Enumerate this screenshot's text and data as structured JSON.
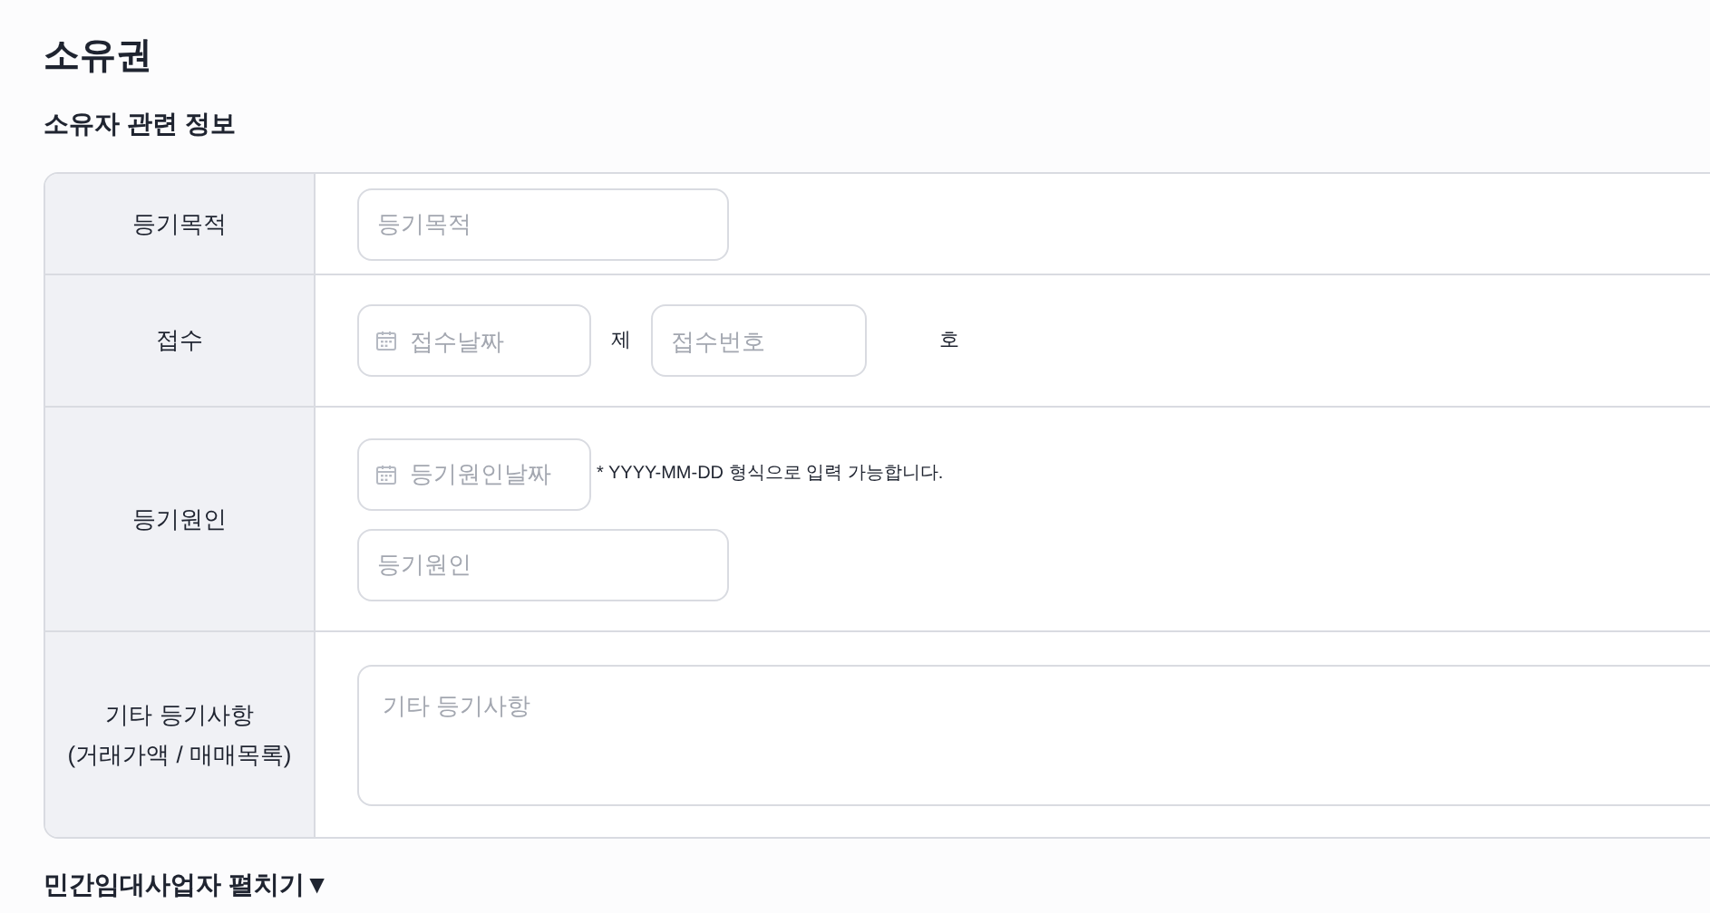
{
  "title": "소유권",
  "subtitle": "소유자 관련 정보",
  "rows": [
    {
      "label": "등기목적",
      "kind": "text",
      "fields": [
        {
          "kind": "text",
          "placeholder": "등기목적"
        }
      ]
    },
    {
      "label": "접수",
      "kind": "receipt",
      "fields": [
        {
          "kind": "date",
          "placeholder": "접수날짜"
        },
        {
          "kind": "unit",
          "text": "제"
        },
        {
          "kind": "number",
          "placeholder": "접수번호"
        },
        {
          "kind": "unit",
          "text": "호"
        }
      ]
    },
    {
      "label": "등기원인",
      "kind": "cause",
      "fields": [
        {
          "kind": "date",
          "placeholder": "등기원인날짜"
        },
        {
          "kind": "hint",
          "text": "* YYYY-MM-DD 형식으로 입력 가능합니다."
        },
        {
          "kind": "text",
          "placeholder": "등기원인"
        }
      ]
    },
    {
      "label": "기타 등기사항\n(거래가액 / 매매목록)",
      "kind": "memo",
      "fields": [
        {
          "kind": "textarea",
          "placeholder": "기타 등기사항"
        }
      ]
    }
  ],
  "toggle": "민간임대사업자 펼치기▼"
}
